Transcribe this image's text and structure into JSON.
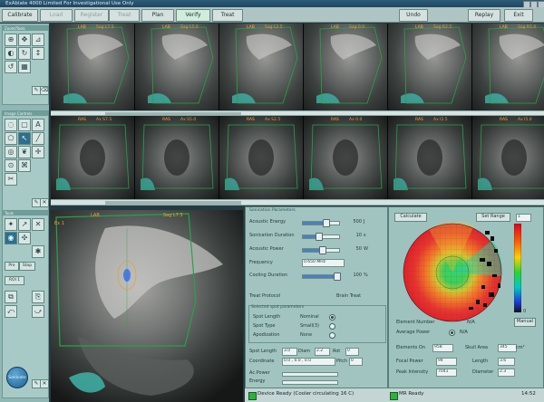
{
  "window": {
    "title": "ExAblate 4000 Limited For Investigational Use Only"
  },
  "toolbar": {
    "buttons": [
      {
        "label": "Calibrate",
        "state": "normal"
      },
      {
        "label": "Load",
        "state": "disabled"
      },
      {
        "label": "Register",
        "state": "disabled"
      },
      {
        "label": "Treat",
        "state": "disabled"
      },
      {
        "label": "Plan",
        "state": "normal"
      },
      {
        "label": "Verify",
        "state": "selected"
      },
      {
        "label": "Treat",
        "state": "normal"
      }
    ],
    "right": [
      {
        "label": "Undo"
      },
      {
        "label": "Replay"
      },
      {
        "label": "Exit"
      }
    ]
  },
  "left_panels": {
    "panel1_header": "Zoom/Tools",
    "panel2_header": "Image Controls",
    "bottom_header": "Tools",
    "buttons": [
      "Pre",
      "Stop",
      "ROI 1"
    ],
    "sonicate_label": "Sonicate"
  },
  "sag_strip": {
    "frames": [
      {
        "label": "LAB",
        "sub": "Sag L7.5"
      },
      {
        "label": "LAB",
        "sub": "Sag L5.0"
      },
      {
        "label": "LAB",
        "sub": "Sag L2.5"
      },
      {
        "label": "LAB",
        "sub": "Sag 0.0"
      },
      {
        "label": "LAB",
        "sub": "Sag R2.5"
      },
      {
        "label": "LAB",
        "sub": "Sag R5.0"
      }
    ]
  },
  "ax_strip": {
    "frames": [
      {
        "label": "RAS",
        "sub": "Ax S7.5"
      },
      {
        "label": "RAS",
        "sub": "Ax S5.0"
      },
      {
        "label": "RAS",
        "sub": "Ax S2.5"
      },
      {
        "label": "RAS",
        "sub": "Ax 0.0"
      },
      {
        "label": "RAS",
        "sub": "Ax I2.5"
      },
      {
        "label": "RAS",
        "sub": "Ax I5.0"
      }
    ]
  },
  "big_view": {
    "label": "LAB",
    "sub": "Sag L7.5",
    "corner": "Ex 1"
  },
  "params": {
    "header": "Sonication Parameters",
    "acoustic_energy": {
      "label": "Acoustic Energy",
      "value": "500",
      "unit": "J"
    },
    "sonication_duration": {
      "label": "Sonication Duration",
      "value": "10",
      "unit": "s"
    },
    "acoustic_power": {
      "label": "Acoustic Power",
      "value": "50",
      "unit": "W"
    },
    "frequency": {
      "label": "Frequency",
      "value": "0.650 MHz"
    },
    "cooling_duration": {
      "label": "Cooling Duration",
      "value": "100",
      "unit": "%"
    },
    "treat_protocol": {
      "label": "Treat Protocol",
      "value": "Brain Treat"
    },
    "spot_header": "Selected spot parameters",
    "spot_length": {
      "label": "Spot Length",
      "value": "Nominal"
    },
    "spot_type": {
      "label": "Spot Type",
      "value": "Small(3)"
    },
    "apodization": {
      "label": "Apodization",
      "value": "None"
    },
    "row1": {
      "spot_length_label": "Spot Length",
      "spot_length": "3.0",
      "diam_label": "Diam",
      "diam": "2.2",
      "rot_label": "Rot",
      "rot": "0"
    },
    "row2": {
      "coord_label": "Coordinate",
      "coord": "0.0 , 0.0 , 0.0",
      "pitch_label": "Pitch",
      "pitch": "0"
    },
    "row3": {
      "ac_power_label": "Ac.Power",
      "energy_label": "Energy"
    }
  },
  "element_map": {
    "calculate_label": "Calculate",
    "set_range_label": "Set Range",
    "top_value": "1",
    "bottom_value": "0",
    "element_number": {
      "label": "Element Number",
      "value": "N/A"
    },
    "average_power": {
      "label": "Average Power",
      "value": "N/A"
    },
    "manual_label": "Manual",
    "elements_on": {
      "label": "Elements On",
      "value": "958"
    },
    "skull_area": {
      "label": "Skull Area",
      "value": "345",
      "unit": "cm²"
    },
    "focal_power": {
      "label": "Focal Power",
      "value": "94"
    },
    "length": {
      "label": "Length",
      "value": "3.6"
    },
    "peak_intensity": {
      "label": "Peak Intensity",
      "value": "7041"
    },
    "diameter": {
      "label": "Diameter",
      "value": "2.3"
    },
    "colorbar": [
      "#e3001b",
      "#ff5a00",
      "#ffd000",
      "#29d431",
      "#00c8c8",
      "#1c3fd8",
      "#101020"
    ]
  },
  "status": {
    "device_ready": "Device Ready (Cooler circulating 16 C)",
    "mr_ready": "MR Ready",
    "time": "14:52"
  }
}
